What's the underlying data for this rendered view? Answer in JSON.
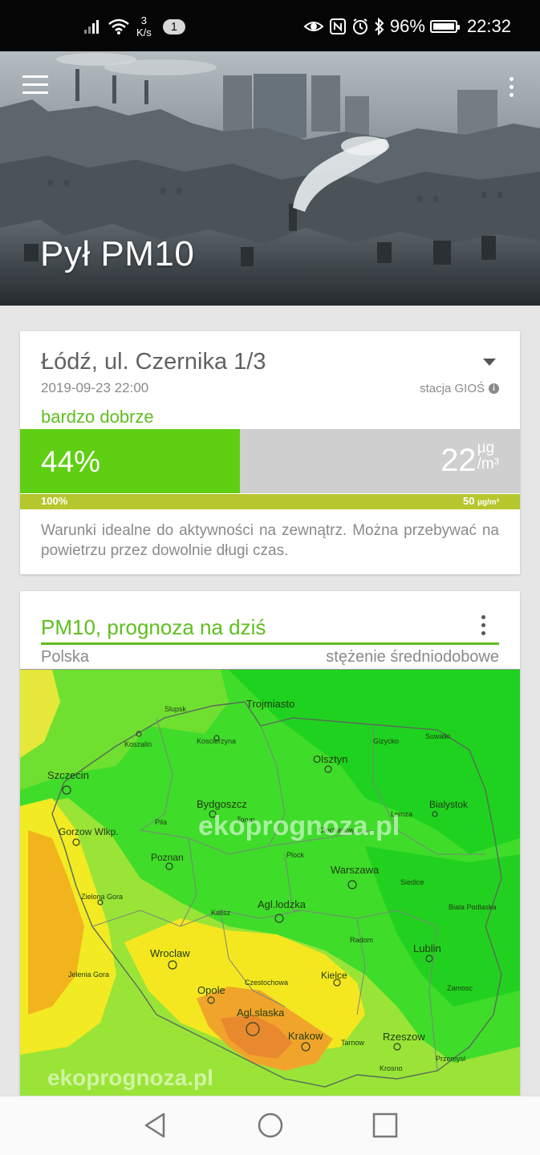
{
  "status_bar": {
    "speed_value": "3",
    "speed_unit": "K/s",
    "notification_count": "1",
    "battery_percent": "96%",
    "time": "22:32",
    "icons": [
      "signal-icon",
      "wifi-icon",
      "eye-icon",
      "nfc-icon",
      "alarm-icon",
      "bluetooth-icon",
      "battery-icon"
    ]
  },
  "header": {
    "title": "Pył PM10",
    "icons": [
      "menu-icon",
      "more-vert-icon"
    ]
  },
  "measurement_card": {
    "location": "Łódź, ul. Czernika 1/3",
    "datetime": "2019-09-23 22:00",
    "station": "stacja GIOŚ",
    "quality": "bardzo dobrze",
    "percent_label": "44%",
    "percent_value": 44,
    "value": "22",
    "unit_top": "µg",
    "unit_bottom": "/m³",
    "scale_left": "100%",
    "scale_right_value": "50",
    "scale_right_unit": "µg/m³",
    "description": "Warunki idealne do aktywności na zewnątrz. Można przebywać na powietrzu przez dowolnie długi czas.",
    "colors": {
      "quality": "#5fbf1e",
      "bar_fill": "#5fcf13",
      "scale": "#b6c62d"
    }
  },
  "forecast_card": {
    "title": "PM10, prognoza na dziś",
    "region": "Polska",
    "type": "stężenie średniodobowe",
    "watermark": "ekoprognoza.pl",
    "cities": {
      "trojmiasto": "Trojmiasto",
      "slupsk": "Slupsk",
      "koscierzyna": "Koscierzyna",
      "koszalin": "Koszalin",
      "gizycko": "Gizycko",
      "suwalki": "Suwalki",
      "olsztyn": "Olsztyn",
      "szczecin": "Szczecin",
      "bydgoszcz": "Bydgoszcz",
      "bialystok": "Bialystok",
      "lomza": "Lomza",
      "torun": "Torun",
      "ciechanow": "Ciechanow",
      "gorzow": "Gorzow Wlkp.",
      "pila": "Pila",
      "poznan": "Poznan",
      "plock": "Plock",
      "warszawa": "Warszawa",
      "siedlce": "Siedlce",
      "zielona_gora": "Zielona Gora",
      "kalisz": "Kalisz",
      "lodz": "Agl.lodzka",
      "biala_podlaska": "Biala Podlaska",
      "radom": "Radom",
      "lublin": "Lublin",
      "wroclaw": "Wroclaw",
      "jelenia_gora": "Jelenia Gora",
      "czestochowa": "Czestochowa",
      "kielce": "Kielce",
      "opole": "Opole",
      "zamosc": "Zamosc",
      "slaska": "Agl.slaska",
      "krakow": "Krakow",
      "tarnow": "Tarnow",
      "rzeszow": "Rzeszow",
      "przemysl": "Przemysl",
      "krosno": "Krosno"
    }
  },
  "nav_bar": {
    "icons": [
      "back-icon",
      "home-icon",
      "recent-apps-icon"
    ]
  }
}
